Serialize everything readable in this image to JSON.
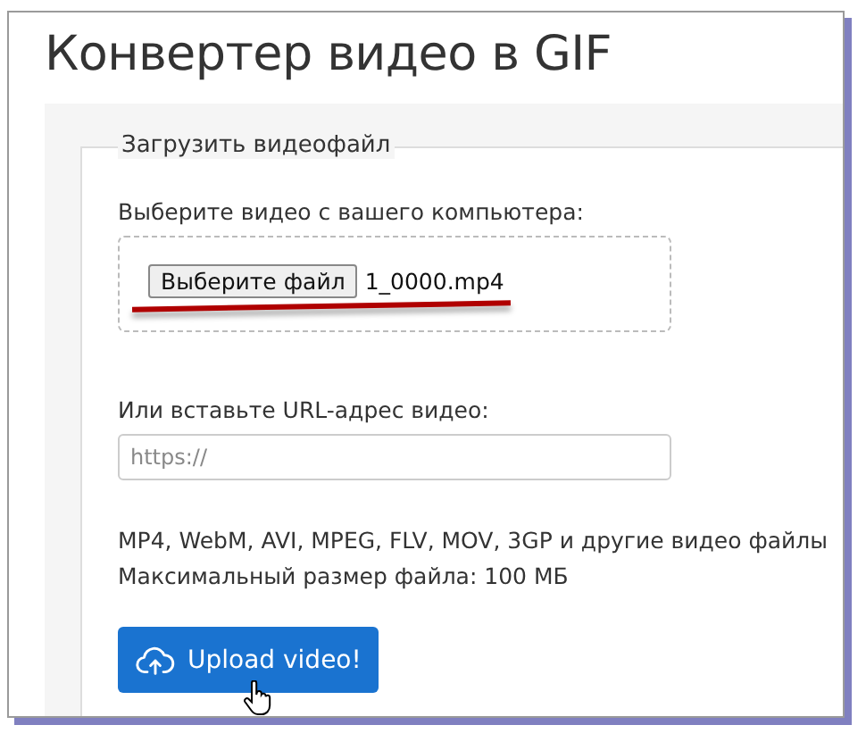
{
  "title": "Конвертер видео в GIF",
  "section": {
    "legend": "Загрузить видеофайл",
    "file_label": "Выберите видео с вашего компьютера:",
    "file_button": "Выберите файл",
    "file_name": "1_0000.mp4",
    "url_label": "Или вставьте URL-адрес видео:",
    "url_placeholder": "https://",
    "info_lines": [
      "MP4, WebM, AVI, MPEG, FLV, MOV, 3GP и другие видео файлы",
      "Максимальный размер файла: 100 МБ"
    ],
    "upload_button": "Upload video!"
  }
}
